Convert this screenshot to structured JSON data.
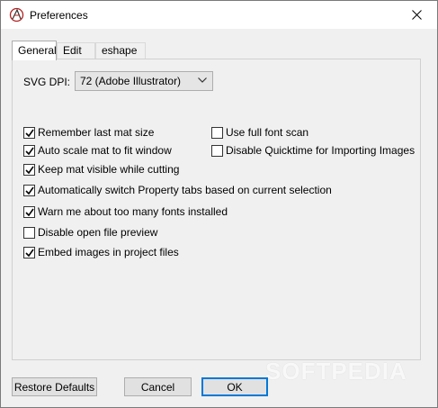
{
  "window": {
    "title": "Preferences"
  },
  "tabs": [
    {
      "label": "General",
      "active": true
    },
    {
      "label": "Edit",
      "active": false
    },
    {
      "label": "eshape",
      "active": false
    }
  ],
  "svg_dpi": {
    "label": "SVG DPI:",
    "value": "72 (Adobe Illustrator)"
  },
  "options": {
    "remember_mat": {
      "label": "Remember last mat size",
      "checked": true
    },
    "auto_scale": {
      "label": "Auto scale mat to fit window",
      "checked": true
    },
    "keep_mat_visible": {
      "label": "Keep mat visible while cutting",
      "checked": true
    },
    "full_font_scan": {
      "label": "Use full font scan",
      "checked": false
    },
    "disable_quicktime": {
      "label": "Disable Quicktime for Importing Images",
      "checked": false
    },
    "auto_switch_tabs": {
      "label": "Automatically switch Property tabs based on current selection",
      "checked": true
    },
    "warn_fonts": {
      "label": "Warn me about too many fonts installed",
      "checked": true
    },
    "disable_preview": {
      "label": "Disable open file preview",
      "checked": false
    },
    "embed_images": {
      "label": "Embed images in project files",
      "checked": true
    }
  },
  "buttons": {
    "restore": "Restore Defaults",
    "cancel": "Cancel",
    "ok": "OK"
  },
  "watermark": "SOFTPEDIA",
  "colors": {
    "accent": "#0078d7",
    "dialog_bg": "#f0f0f0"
  }
}
